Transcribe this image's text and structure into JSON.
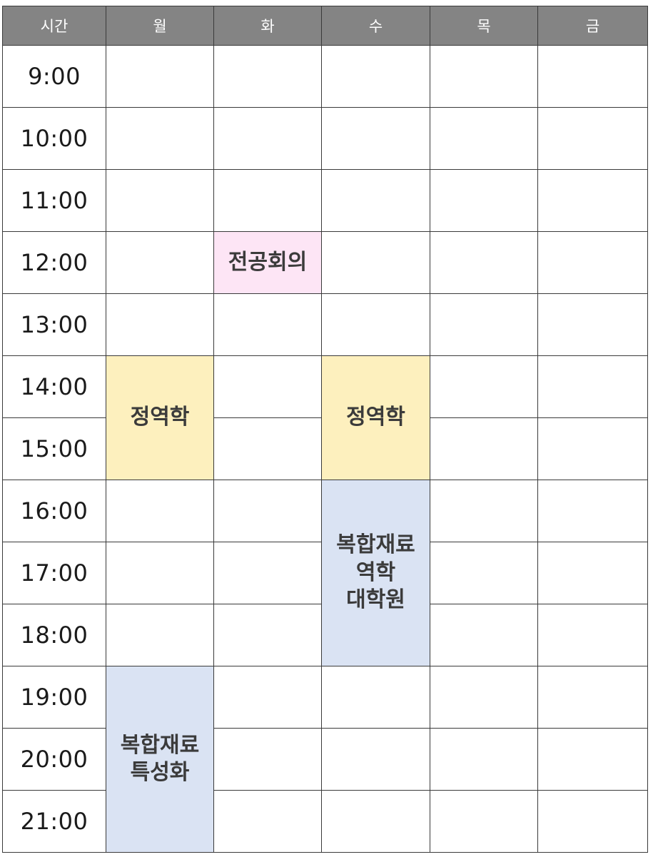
{
  "header": {
    "time": "시간",
    "days": [
      "월",
      "화",
      "수",
      "목",
      "금"
    ]
  },
  "times": [
    "9:00",
    "10:00",
    "11:00",
    "12:00",
    "13:00",
    "14:00",
    "15:00",
    "16:00",
    "17:00",
    "18:00",
    "19:00",
    "20:00",
    "21:00"
  ],
  "events": {
    "tue_noon": {
      "lines": [
        "전공회의"
      ],
      "day": "화",
      "start": "12:00",
      "end": "13:00",
      "color": "#fde5f5"
    },
    "mon_afternoon": {
      "lines": [
        "정역학"
      ],
      "day": "월",
      "start": "14:00",
      "end": "16:00",
      "color": "#fdf0be"
    },
    "wed_afternoon": {
      "lines": [
        "정역학"
      ],
      "day": "수",
      "start": "14:00",
      "end": "16:00",
      "color": "#fdf0be"
    },
    "wed_evening": {
      "lines": [
        "복합재료",
        "역학",
        "대학원"
      ],
      "day": "수",
      "start": "16:00",
      "end": "19:00",
      "color": "#dae3f3"
    },
    "mon_evening": {
      "lines": [
        "복합재료",
        "특성화"
      ],
      "day": "월",
      "start": "19:00",
      "end": "22:00",
      "color": "#dae3f3"
    }
  },
  "colors": {
    "header_bg": "#848484",
    "grid_line": "#3a3a3a"
  }
}
